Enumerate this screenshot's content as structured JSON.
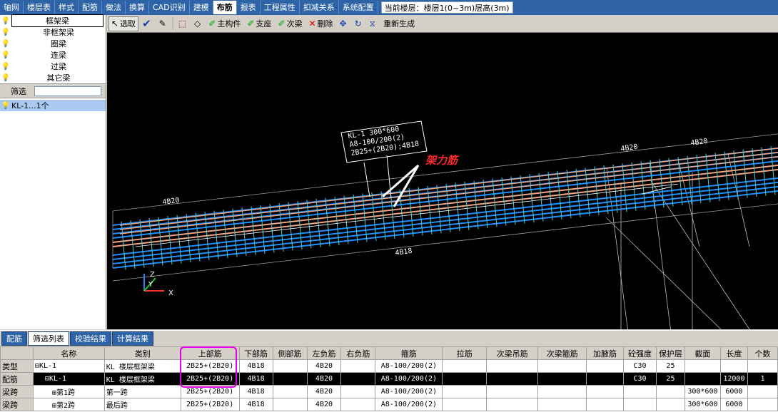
{
  "menu": {
    "tabs": [
      "轴网",
      "楼层表",
      "样式",
      "配筋",
      "做法",
      "换算",
      "CAD识别",
      "建模",
      "布筋",
      "报表",
      "工程属性",
      "扣减关系",
      "系统配置"
    ],
    "active_index": 8,
    "floor_info": "当前楼层：楼层1(0~3m)层高(3m)"
  },
  "left_panel": {
    "categories": [
      "框架梁",
      "非框架梁",
      "圈梁",
      "连梁",
      "过梁",
      "其它梁"
    ],
    "selected_index": 0,
    "filter_label": "筛选",
    "filter_value": "",
    "component": "KL-1...1个"
  },
  "toolbar": {
    "select": "选取",
    "main_member": "主构件",
    "support": "支座",
    "secondary_beam": "次梁",
    "delete": "删除",
    "regenerate": "重新生成"
  },
  "viewport": {
    "beam_label_lines": [
      "KL-1 300*600",
      "A8-100/200(2)",
      "2B25+(2B20);4B18"
    ],
    "annotation": "架力筋",
    "rebar_tags": [
      "4B20",
      "4B20",
      "4B18",
      "4B20",
      "4B20"
    ],
    "axis_z": "Z",
    "axis_y": "Y",
    "axis_x": "X"
  },
  "bottom_tabs": {
    "labels": [
      "配筋",
      "筛选列表",
      "校验结果",
      "计算结果"
    ],
    "active_index": 1
  },
  "grid": {
    "headers": [
      "",
      "名称",
      "类别",
      "上部筋",
      "下部筋",
      "侧部筋",
      "左负筋",
      "右负筋",
      "箍筋",
      "拉筋",
      "次梁吊筋",
      "次梁箍筋",
      "加腋筋",
      "砼强度",
      "保护层",
      "截面",
      "长度",
      "个数"
    ],
    "rows": [
      [
        "类型",
        "⊟KL-1",
        "KL  楼层框架梁",
        "2B25+(2B20)",
        "4B18",
        "",
        "4B20",
        "",
        "A8-100/200(2)",
        "",
        "",
        "",
        "",
        "C30",
        "25",
        "",
        "",
        ""
      ],
      [
        "配筋",
        "⊟KL-1",
        "KL  楼层框架梁",
        "2B25+(2B20)",
        "4B18",
        "",
        "4B20",
        "",
        "A8-100/200(2)",
        "",
        "",
        "",
        "",
        "C30",
        "25",
        "",
        "12000",
        "1"
      ],
      [
        "梁跨",
        "⊞第1跨",
        "第一跨",
        "2B25+(2B20)",
        "4B18",
        "",
        "4B20",
        "",
        "A8-100/200(2)",
        "",
        "",
        "",
        "",
        "",
        "",
        "300*600",
        "6000",
        ""
      ],
      [
        "梁跨",
        "⊞第2跨",
        "最后跨",
        "2B25+(2B20)",
        "4B18",
        "",
        "4B20",
        "",
        "A8-100/200(2)",
        "",
        "",
        "",
        "",
        "",
        "",
        "300*600",
        "6000",
        ""
      ]
    ],
    "selected_row": 1,
    "highlight_column": "上部筋"
  },
  "colors": {
    "rebar_top": "#f4a582",
    "rebar_main": "#1e90ff",
    "stirrup": "#40d0e0",
    "annotation": "#ff2a2a",
    "highlight": "#e000e0"
  }
}
